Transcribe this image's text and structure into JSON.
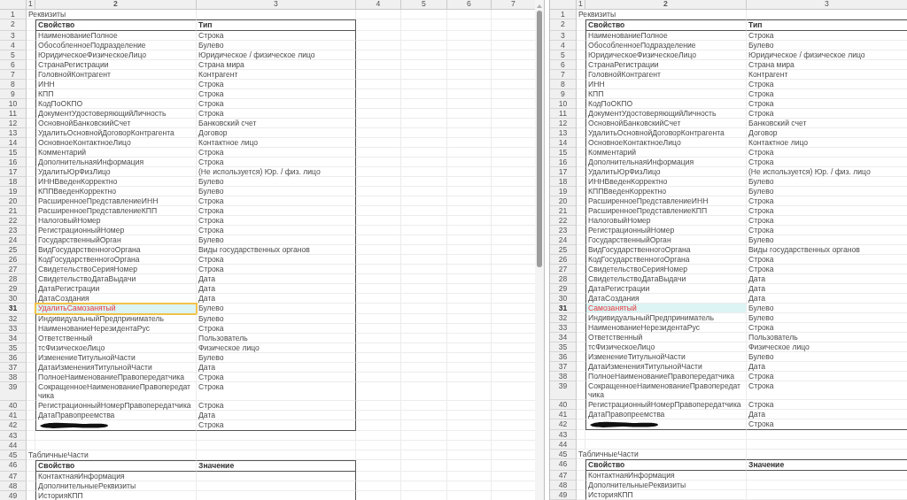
{
  "panes": [
    {
      "scrollbar": true,
      "cursor_frame": true,
      "column_headers": [
        {
          "label": "1",
          "selected": false
        },
        {
          "label": "2",
          "selected": true
        },
        {
          "label": "3",
          "selected": false
        },
        {
          "label": "4",
          "selected": false
        },
        {
          "label": "5",
          "selected": false
        },
        {
          "label": "6",
          "selected": false
        },
        {
          "label": "7",
          "selected": false
        }
      ],
      "rows": [
        {
          "num": "1",
          "kind": "title",
          "text": "Реквизиты"
        },
        {
          "num": "2",
          "kind": "header",
          "cells": [
            "Свойство",
            "Тип"
          ]
        },
        {
          "num": "3",
          "kind": "item",
          "property": "НаименованиеПолное",
          "type": "Строка",
          "changed": false,
          "selected": false
        },
        {
          "num": "4",
          "kind": "item",
          "property": "ОбособленноеПодразделение",
          "type": "Булево",
          "changed": false,
          "selected": false
        },
        {
          "num": "5",
          "kind": "item",
          "property": "ЮридическоеФизическоеЛицо",
          "type": "Юридическое / физическое лицо",
          "changed": false,
          "selected": false
        },
        {
          "num": "6",
          "kind": "item",
          "property": "СтранаРегистрации",
          "type": "Страна мира",
          "changed": false,
          "selected": false
        },
        {
          "num": "7",
          "kind": "item",
          "property": "ГоловнойКонтрагент",
          "type": "Контрагент",
          "changed": false,
          "selected": false
        },
        {
          "num": "8",
          "kind": "item",
          "property": "ИНН",
          "type": "Строка",
          "changed": false,
          "selected": false
        },
        {
          "num": "9",
          "kind": "item",
          "property": "КПП",
          "type": "Строка",
          "changed": false,
          "selected": false
        },
        {
          "num": "10",
          "kind": "item",
          "property": "КодПоОКПО",
          "type": "Строка",
          "changed": false,
          "selected": false
        },
        {
          "num": "11",
          "kind": "item",
          "property": "ДокументУдостоверяющийЛичность",
          "type": "Строка",
          "changed": false,
          "selected": false
        },
        {
          "num": "12",
          "kind": "item",
          "property": "ОсновнойБанковскийСчет",
          "type": "Банковский счет",
          "changed": false,
          "selected": false
        },
        {
          "num": "13",
          "kind": "item",
          "property": "УдалитьОсновнойДоговорКонтрагента",
          "type": "Договор",
          "changed": false,
          "selected": false
        },
        {
          "num": "14",
          "kind": "item",
          "property": "ОсновноеКонтактноеЛицо",
          "type": "Контактное лицо",
          "changed": false,
          "selected": false
        },
        {
          "num": "15",
          "kind": "item",
          "property": "Комментарий",
          "type": "Строка",
          "changed": false,
          "selected": false
        },
        {
          "num": "16",
          "kind": "item",
          "property": "ДополнительнаяИнформация",
          "type": "Строка",
          "changed": false,
          "selected": false
        },
        {
          "num": "17",
          "kind": "item",
          "property": "УдалитьЮрФизЛицо",
          "type": "(Не используется) Юр. / физ. лицо",
          "changed": false,
          "selected": false
        },
        {
          "num": "18",
          "kind": "item",
          "property": "ИННВведенКорректно",
          "type": "Булево",
          "changed": false,
          "selected": false
        },
        {
          "num": "19",
          "kind": "item",
          "property": "КППВведенКорректно",
          "type": "Булево",
          "changed": false,
          "selected": false
        },
        {
          "num": "20",
          "kind": "item",
          "property": "РасширенноеПредставлениеИНН",
          "type": "Строка",
          "changed": false,
          "selected": false
        },
        {
          "num": "21",
          "kind": "item",
          "property": "РасширенноеПредставлениеКПП",
          "type": "Строка",
          "changed": false,
          "selected": false
        },
        {
          "num": "22",
          "kind": "item",
          "property": "НалоговыйНомер",
          "type": "Строка",
          "changed": false,
          "selected": false
        },
        {
          "num": "23",
          "kind": "item",
          "property": "РегистрационныйНомер",
          "type": "Строка",
          "changed": false,
          "selected": false
        },
        {
          "num": "24",
          "kind": "item",
          "property": "ГосударственныйОрган",
          "type": "Булево",
          "changed": false,
          "selected": false
        },
        {
          "num": "25",
          "kind": "item",
          "property": "ВидГосударственногоОргана",
          "type": "Виды государственных органов",
          "changed": false,
          "selected": false
        },
        {
          "num": "26",
          "kind": "item",
          "property": "КодГосударственногоОргана",
          "type": "Строка",
          "changed": false,
          "selected": false
        },
        {
          "num": "27",
          "kind": "item",
          "property": "СвидетельствоСерияНомер",
          "type": "Строка",
          "changed": false,
          "selected": false
        },
        {
          "num": "28",
          "kind": "item",
          "property": "СвидетельствоДатаВыдачи",
          "type": "Дата",
          "changed": false,
          "selected": false
        },
        {
          "num": "29",
          "kind": "item",
          "property": "ДатаРегистрации",
          "type": "Дата",
          "changed": false,
          "selected": false
        },
        {
          "num": "30",
          "kind": "item",
          "property": "ДатаСоздания",
          "type": "Дата",
          "changed": false,
          "selected": false
        },
        {
          "num": "31",
          "kind": "item",
          "property": "УдалитьСамозанятый",
          "type": "Булево",
          "changed": true,
          "selected": true
        },
        {
          "num": "32",
          "kind": "item",
          "property": "ИндивидуальныйПредприниматель",
          "type": "Булево",
          "changed": false,
          "selected": false
        },
        {
          "num": "33",
          "kind": "item",
          "property": "НаименованиеНерезидентаРус",
          "type": "Строка",
          "changed": false,
          "selected": false
        },
        {
          "num": "34",
          "kind": "item",
          "property": "Ответственный",
          "type": "Пользователь",
          "changed": false,
          "selected": false
        },
        {
          "num": "35",
          "kind": "item",
          "property": "тсФизическоеЛицо",
          "type": "Физическое лицо",
          "changed": false,
          "selected": false
        },
        {
          "num": "36",
          "kind": "item",
          "property": "ИзменениеТитульнойЧасти",
          "type": "Булево",
          "changed": false,
          "selected": false
        },
        {
          "num": "37",
          "kind": "item",
          "property": "ДатаИзмененияТитульнойЧасти",
          "type": "Дата",
          "changed": false,
          "selected": false
        },
        {
          "num": "38",
          "kind": "item",
          "property": "ПолноеНаименованиеПравопередатчика",
          "type": "Строка",
          "changed": false,
          "selected": false
        },
        {
          "num": "39",
          "kind": "item",
          "property": "СокращенноеНаименованиеПравопередатчика",
          "type": "Строка",
          "changed": false,
          "selected": false
        },
        {
          "num": "40",
          "kind": "item",
          "property": "РегистрационныйНомерПравопередатчика",
          "type": "Строка",
          "changed": false,
          "selected": false
        },
        {
          "num": "41",
          "kind": "item",
          "property": "ДатаПравопреемства",
          "type": "Дата",
          "changed": false,
          "selected": false
        },
        {
          "num": "42",
          "kind": "redacted",
          "type": "Строка",
          "changed": false,
          "selected": false
        },
        {
          "num": "43",
          "kind": "blank"
        },
        {
          "num": "44",
          "kind": "blank"
        },
        {
          "num": "45",
          "kind": "title",
          "text": "ТабличныеЧасти"
        },
        {
          "num": "46",
          "kind": "header",
          "cells": [
            "Свойство",
            "Значение"
          ]
        },
        {
          "num": "47",
          "kind": "item",
          "property": "КонтактнаяИнформация",
          "changed": false,
          "selected": false
        },
        {
          "num": "48",
          "kind": "item",
          "property": "ДополнительныеРеквизиты",
          "changed": false,
          "selected": false
        },
        {
          "num": "49",
          "kind": "item",
          "property": "ИсторияКПП",
          "changed": false,
          "selected": false
        }
      ]
    },
    {
      "scrollbar": false,
      "cursor_frame": false,
      "column_headers": [
        {
          "label": "1",
          "selected": false
        },
        {
          "label": "2",
          "selected": true
        },
        {
          "label": "3",
          "selected": false
        }
      ],
      "rows": [
        {
          "num": "1",
          "kind": "title",
          "text": "Реквизиты"
        },
        {
          "num": "2",
          "kind": "header",
          "cells": [
            "Свойство",
            "Тип"
          ]
        },
        {
          "num": "3",
          "kind": "item",
          "property": "НаименованиеПолное",
          "type": "Строка",
          "changed": false,
          "selected": false
        },
        {
          "num": "4",
          "kind": "item",
          "property": "ОбособленноеПодразделение",
          "type": "Булево",
          "changed": false,
          "selected": false
        },
        {
          "num": "5",
          "kind": "item",
          "property": "ЮридическоеФизическоеЛицо",
          "type": "Юридическое / физическое лицо",
          "changed": false,
          "selected": false
        },
        {
          "num": "6",
          "kind": "item",
          "property": "СтранаРегистрации",
          "type": "Страна мира",
          "changed": false,
          "selected": false
        },
        {
          "num": "7",
          "kind": "item",
          "property": "ГоловнойКонтрагент",
          "type": "Контрагент",
          "changed": false,
          "selected": false
        },
        {
          "num": "8",
          "kind": "item",
          "property": "ИНН",
          "type": "Строка",
          "changed": false,
          "selected": false
        },
        {
          "num": "9",
          "kind": "item",
          "property": "КПП",
          "type": "Строка",
          "changed": false,
          "selected": false
        },
        {
          "num": "10",
          "kind": "item",
          "property": "КодПоОКПО",
          "type": "Строка",
          "changed": false,
          "selected": false
        },
        {
          "num": "11",
          "kind": "item",
          "property": "ДокументУдостоверяющийЛичность",
          "type": "Строка",
          "changed": false,
          "selected": false
        },
        {
          "num": "12",
          "kind": "item",
          "property": "ОсновнойБанковскийСчет",
          "type": "Банковский счет",
          "changed": false,
          "selected": false
        },
        {
          "num": "13",
          "kind": "item",
          "property": "УдалитьОсновнойДоговорКонтрагента",
          "type": "Договор",
          "changed": false,
          "selected": false
        },
        {
          "num": "14",
          "kind": "item",
          "property": "ОсновноеКонтактноеЛицо",
          "type": "Контактное лицо",
          "changed": false,
          "selected": false
        },
        {
          "num": "15",
          "kind": "item",
          "property": "Комментарий",
          "type": "Строка",
          "changed": false,
          "selected": false
        },
        {
          "num": "16",
          "kind": "item",
          "property": "ДополнительнаяИнформация",
          "type": "Строка",
          "changed": false,
          "selected": false
        },
        {
          "num": "17",
          "kind": "item",
          "property": "УдалитьЮрФизЛицо",
          "type": "(Не используется) Юр. / физ. лицо",
          "changed": false,
          "selected": false
        },
        {
          "num": "18",
          "kind": "item",
          "property": "ИННВведенКорректно",
          "type": "Булево",
          "changed": false,
          "selected": false
        },
        {
          "num": "19",
          "kind": "item",
          "property": "КППВведенКорректно",
          "type": "Булево",
          "changed": false,
          "selected": false
        },
        {
          "num": "20",
          "kind": "item",
          "property": "РасширенноеПредставлениеИНН",
          "type": "Строка",
          "changed": false,
          "selected": false
        },
        {
          "num": "21",
          "kind": "item",
          "property": "РасширенноеПредставлениеКПП",
          "type": "Строка",
          "changed": false,
          "selected": false
        },
        {
          "num": "22",
          "kind": "item",
          "property": "НалоговыйНомер",
          "type": "Строка",
          "changed": false,
          "selected": false
        },
        {
          "num": "23",
          "kind": "item",
          "property": "РегистрационныйНомер",
          "type": "Строка",
          "changed": false,
          "selected": false
        },
        {
          "num": "24",
          "kind": "item",
          "property": "ГосударственныйОрган",
          "type": "Булево",
          "changed": false,
          "selected": false
        },
        {
          "num": "25",
          "kind": "item",
          "property": "ВидГосударственногоОргана",
          "type": "Виды государственных органов",
          "changed": false,
          "selected": false
        },
        {
          "num": "26",
          "kind": "item",
          "property": "КодГосударственногоОргана",
          "type": "Строка",
          "changed": false,
          "selected": false
        },
        {
          "num": "27",
          "kind": "item",
          "property": "СвидетельствоСерияНомер",
          "type": "Строка",
          "changed": false,
          "selected": false
        },
        {
          "num": "28",
          "kind": "item",
          "property": "СвидетельствоДатаВыдачи",
          "type": "Дата",
          "changed": false,
          "selected": false
        },
        {
          "num": "29",
          "kind": "item",
          "property": "ДатаРегистрации",
          "type": "Дата",
          "changed": false,
          "selected": false
        },
        {
          "num": "30",
          "kind": "item",
          "property": "ДатаСоздания",
          "type": "Дата",
          "changed": false,
          "selected": false
        },
        {
          "num": "31",
          "kind": "item",
          "property": "Самозанятый",
          "type": "Булево",
          "changed": true,
          "selected": true
        },
        {
          "num": "32",
          "kind": "item",
          "property": "ИндивидуальныйПредприниматель",
          "type": "Булево",
          "changed": false,
          "selected": false
        },
        {
          "num": "33",
          "kind": "item",
          "property": "НаименованиеНерезидентаРус",
          "type": "Строка",
          "changed": false,
          "selected": false
        },
        {
          "num": "34",
          "kind": "item",
          "property": "Ответственный",
          "type": "Пользователь",
          "changed": false,
          "selected": false
        },
        {
          "num": "35",
          "kind": "item",
          "property": "тсФизическоеЛицо",
          "type": "Физическое лицо",
          "changed": false,
          "selected": false
        },
        {
          "num": "36",
          "kind": "item",
          "property": "ИзменениеТитульнойЧасти",
          "type": "Булево",
          "changed": false,
          "selected": false
        },
        {
          "num": "37",
          "kind": "item",
          "property": "ДатаИзмененияТитульнойЧасти",
          "type": "Дата",
          "changed": false,
          "selected": false
        },
        {
          "num": "38",
          "kind": "item",
          "property": "ПолноеНаименованиеПравопередатчика",
          "type": "Строка",
          "changed": false,
          "selected": false
        },
        {
          "num": "39",
          "kind": "item",
          "property": "СокращенноеНаименованиеПравопередатчика",
          "type": "Строка",
          "changed": false,
          "selected": false
        },
        {
          "num": "40",
          "kind": "item",
          "property": "РегистрационныйНомерПравопередатчика",
          "type": "Строка",
          "changed": false,
          "selected": false
        },
        {
          "num": "41",
          "kind": "item",
          "property": "ДатаПравопреемства",
          "type": "Дата",
          "changed": false,
          "selected": false
        },
        {
          "num": "42",
          "kind": "redacted",
          "type": "Строка",
          "changed": false,
          "selected": false
        },
        {
          "num": "43",
          "kind": "blank"
        },
        {
          "num": "44",
          "kind": "blank"
        },
        {
          "num": "45",
          "kind": "title",
          "text": "ТабличныеЧасти"
        },
        {
          "num": "46",
          "kind": "header",
          "cells": [
            "Свойство",
            "Значение"
          ]
        },
        {
          "num": "47",
          "kind": "item",
          "property": "КонтактнаяИнформация",
          "changed": false,
          "selected": false
        },
        {
          "num": "48",
          "kind": "item",
          "property": "ДополнительныеРеквизиты",
          "changed": false,
          "selected": false
        },
        {
          "num": "49",
          "kind": "item",
          "property": "ИсторияКПП",
          "changed": false,
          "selected": false
        }
      ]
    }
  ]
}
